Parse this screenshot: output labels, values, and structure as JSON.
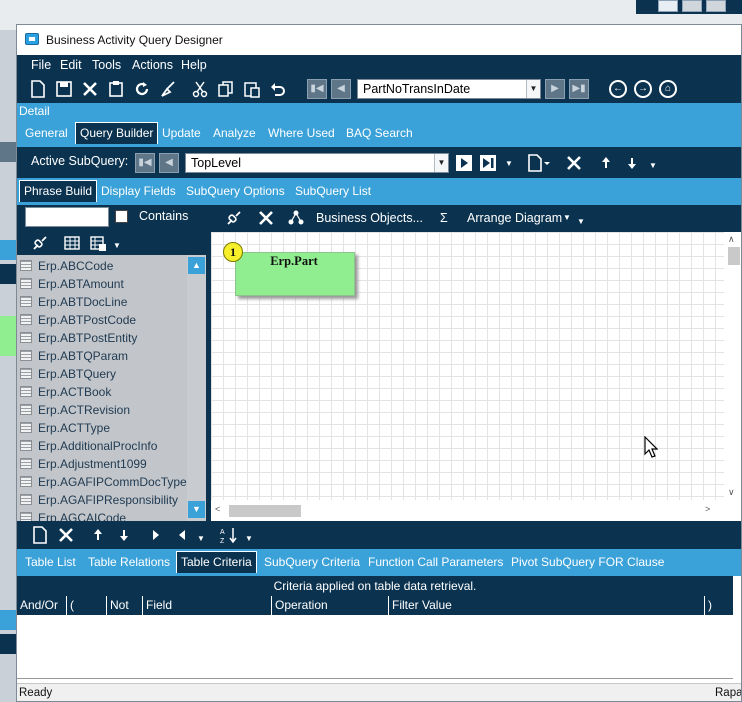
{
  "window": {
    "title": "Business Activity Query Designer"
  },
  "menu": [
    "File",
    "Edit",
    "Tools",
    "Actions",
    "Help"
  ],
  "toolbar": {
    "query_combo": "PartNoTransInDate",
    "icons": [
      "new-icon",
      "save-icon",
      "delete-icon",
      "clipboard-icon",
      "refresh-icon",
      "clear-icon",
      "cut-icon",
      "copy-icon",
      "paste-icon",
      "undo-icon",
      "first-icon",
      "prev-icon",
      "next-icon",
      "last-icon",
      "back-icon",
      "forward-icon",
      "home-icon"
    ]
  },
  "detail_label": "Detail",
  "main_tabs": [
    {
      "label": "General",
      "active": false
    },
    {
      "label": "Query Builder",
      "active": true
    },
    {
      "label": "Update",
      "active": false
    },
    {
      "label": "Analyze",
      "active": false
    },
    {
      "label": "Where Used",
      "active": false
    },
    {
      "label": "BAQ Search",
      "active": false
    }
  ],
  "subquery": {
    "label": "Active SubQuery:",
    "value": "TopLevel"
  },
  "sub_tabs": [
    {
      "label": "Phrase Build",
      "active": true
    },
    {
      "label": "Display Fields",
      "active": false
    },
    {
      "label": "SubQuery Options",
      "active": false
    },
    {
      "label": "SubQuery List",
      "active": false
    }
  ],
  "left_pane": {
    "contains_label": "Contains",
    "filter_value": "",
    "tables": [
      "Erp.ABCCode",
      "Erp.ABTAmount",
      "Erp.ABTDocLine",
      "Erp.ABTPostCode",
      "Erp.ABTPostEntity",
      "Erp.ABTQParam",
      "Erp.ABTQuery",
      "Erp.ACTBook",
      "Erp.ACTRevision",
      "Erp.ACTType",
      "Erp.AdditionalProcInfo",
      "Erp.Adjustment1099",
      "Erp.AGAFIPCommDocType",
      "Erp.AGAFIPResponsibility",
      "Erp.AGCAICode"
    ]
  },
  "diagram_tools": {
    "business_objects": "Business Objects...",
    "sigma": "Σ",
    "arrange": "Arrange Diagram"
  },
  "diagram": {
    "node_name": "Erp.Part",
    "node_number": "1",
    "node_color": "#90ee90"
  },
  "criteria_tabs": [
    {
      "label": "Table List",
      "active": false
    },
    {
      "label": "Table Relations",
      "active": false
    },
    {
      "label": "Table Criteria",
      "active": true
    },
    {
      "label": "SubQuery Criteria",
      "active": false
    },
    {
      "label": "Function Call Parameters",
      "active": false
    },
    {
      "label": "Pivot SubQuery FOR Clause",
      "active": false
    }
  ],
  "criteria_caption": "Criteria applied on  table data retrieval.",
  "criteria_columns": [
    "And/Or",
    "(",
    "Not",
    "Field",
    "Operation",
    "Filter Value",
    ")"
  ],
  "status": {
    "left": "Ready",
    "right": "Rapa"
  },
  "colors": {
    "navy": "#0b3350",
    "accent": "#3ba2d9",
    "list_bg": "#c2c5c9"
  }
}
